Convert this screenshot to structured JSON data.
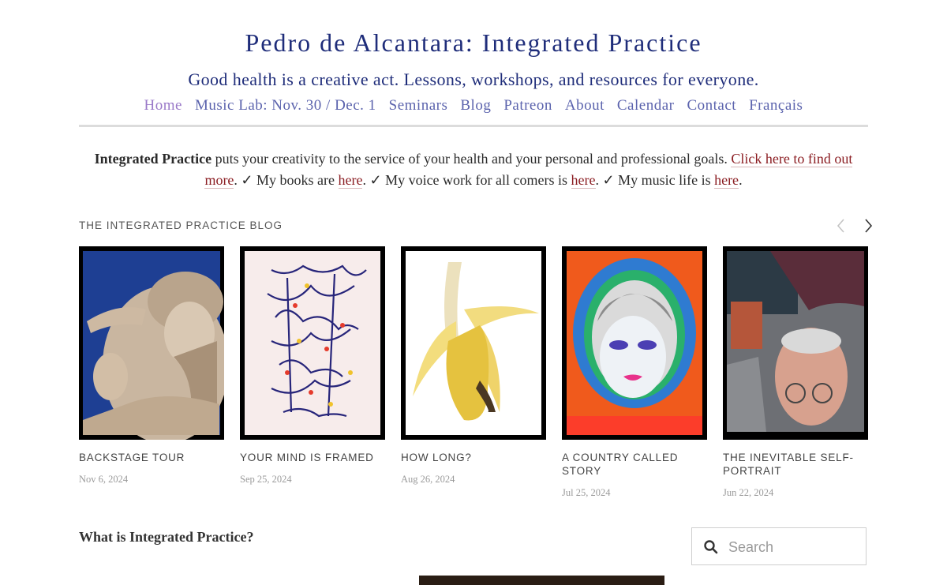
{
  "site": {
    "title": "Pedro de Alcantara: Integrated Practice",
    "tagline": "Good health is a creative act. Lessons, workshops, and resources for everyone."
  },
  "nav": {
    "items": [
      {
        "label": "Home",
        "active": true
      },
      {
        "label": "Music Lab: Nov. 30 / Dec. 1"
      },
      {
        "label": "Seminars"
      },
      {
        "label": "Blog"
      },
      {
        "label": "Patreon"
      },
      {
        "label": "About"
      },
      {
        "label": "Calendar"
      },
      {
        "label": "Contact"
      },
      {
        "label": "Français"
      }
    ]
  },
  "intro": {
    "bold": "Integrated Practice",
    "text1": " puts your creativity to the service of your health and your personal and professional goals. ",
    "link1": "Click here to find out more",
    "text2": ". ✓ My books are ",
    "link2": "here",
    "text3": ". ✓ My voice work for all comers is ",
    "link3": "here",
    "text4": ". ✓ My music life is ",
    "link4": "here",
    "text5": "."
  },
  "blog": {
    "heading": "THE INTEGRATED PRACTICE BLOG",
    "posts": [
      {
        "title": "BACKSTAGE TOUR",
        "date": "Nov 6, 2024"
      },
      {
        "title": "YOUR MIND IS FRAMED",
        "date": "Sep 25, 2024"
      },
      {
        "title": "HOW LONG?",
        "date": "Aug 26, 2024"
      },
      {
        "title": "A COUNTRY CALLED STORY",
        "date": "Jul 25, 2024"
      },
      {
        "title": "THE INEVITABLE SELF-PORTRAIT",
        "date": "Jun 22, 2024"
      }
    ]
  },
  "section": {
    "title": "What is Integrated Practice?"
  },
  "search": {
    "placeholder": "Search"
  },
  "colors": {
    "title": "#1f2d7a",
    "nav": "#5b63ad",
    "nav_active": "#9a79c8",
    "link": "#8b1d22"
  },
  "icons": [
    "chevron-left-icon",
    "chevron-right-icon",
    "search-icon"
  ]
}
